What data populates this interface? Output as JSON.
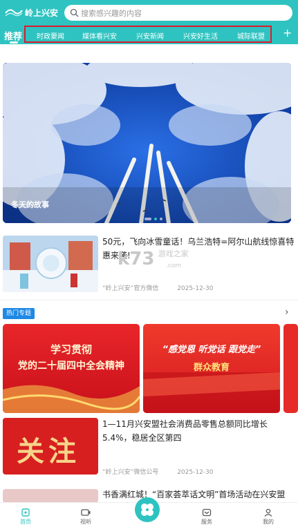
{
  "header": {
    "app_name": "岭上兴安",
    "search_placeholder": "搜索感兴趣的内容",
    "home_tab": "推荐",
    "tabs": [
      "时政要闻",
      "媒体看兴安",
      "兴安新闻",
      "兴安好生活",
      "城际联盟"
    ],
    "add_icon": "plus-icon"
  },
  "banner": {
    "caption": "冬天的故事",
    "dot_count": 3,
    "active_dot": 1
  },
  "news": [
    {
      "title": "50元，飞向冰雪童话！乌兰浩特=阿尔山航线惊喜特惠来袭!",
      "source": "“岭上兴安”官方微信",
      "date": "2025-12-30"
    },
    {
      "title": "1—11月兴安盟社会消费品零售总额同比增长5.4%，稳居全区第四",
      "source": "“岭上兴安”微信公号",
      "date": "2025-12-30"
    },
    {
      "title": "书香满红城！“百家荟萃话文明”首场活动在兴安盟"
    }
  ],
  "hot": {
    "badge": "热门专题",
    "cards": [
      {
        "line1": "学习贯彻",
        "line2": "党的二十届四中全会精神"
      },
      {
        "line1": "“感党恩 听党话 跟党走”",
        "line2": "群众教育"
      }
    ]
  },
  "thumb2_text": "关注",
  "watermark": {
    "brand": "k73",
    "sub": "游戏之家",
    "url": ".com"
  },
  "bottom_nav": [
    {
      "label": "首页",
      "icon": "home-icon"
    },
    {
      "label": "视听",
      "icon": "video-icon"
    },
    {
      "label": "",
      "icon": "clover-icon"
    },
    {
      "label": "服务",
      "icon": "service-icon"
    },
    {
      "label": "我的",
      "icon": "user-icon"
    }
  ],
  "colors": {
    "brand": "#2ec3c0",
    "tab_highlight_border": "#e0182d",
    "hot_badge": "#1e88e5"
  }
}
